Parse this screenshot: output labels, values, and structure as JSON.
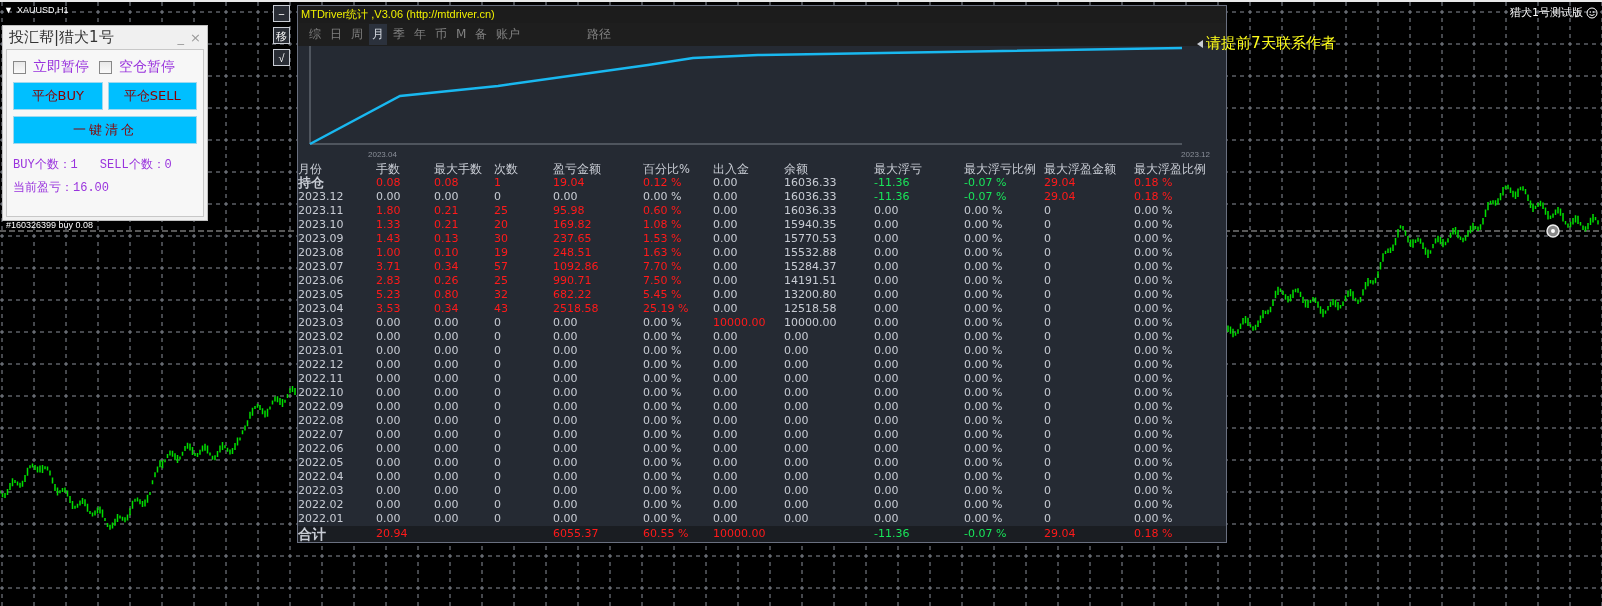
{
  "chart_header": {
    "menu_glyph": "▼",
    "symbol": "XAUUSD,H1"
  },
  "version_badge": "猎犬1号测试版",
  "side_buttons": [
    "−",
    "移",
    "√"
  ],
  "order_label": "#160326399 buy 0.08",
  "control_panel": {
    "title": "投汇帮|猎犬1号",
    "minimize": "_",
    "close": "×",
    "checkboxes": [
      {
        "label": "立即暂停",
        "checked": false
      },
      {
        "label": "空仓暂停",
        "checked": false
      }
    ],
    "buttons": [
      "平仓BUY",
      "平仓SELL"
    ],
    "wide_button": "一键清仓",
    "counts": [
      "BUY个数：1",
      "SELL个数：0"
    ],
    "profit": "当前盈亏：16.00"
  },
  "notice": "请提前7天联系作者",
  "stats_window": {
    "title": "MTDriver统计 ,V3.06 (http://mtdriver.cn)",
    "tabs": [
      {
        "label": "综",
        "selected": false
      },
      {
        "label": "日",
        "selected": false
      },
      {
        "label": "周",
        "selected": false
      },
      {
        "label": "月",
        "selected": true
      },
      {
        "label": "季",
        "selected": false
      },
      {
        "label": "年",
        "selected": false
      },
      {
        "label": "币",
        "selected": false
      },
      {
        "label": "M",
        "selected": false
      },
      {
        "label": "备",
        "selected": false
      },
      {
        "label": "账户",
        "selected": false
      },
      {
        "label": "路径",
        "selected": false
      }
    ],
    "curve": {
      "x_labels": [
        "2023.04",
        "2023.12"
      ]
    },
    "table": {
      "columns": [
        "月份",
        "手数",
        "最大手数",
        "次数",
        "盈亏金额",
        "百分比%",
        "出入金",
        "余额",
        "最大浮亏",
        "最大浮亏比例",
        "最大浮盈金额",
        "最大浮盈比例"
      ],
      "rows": [
        {
          "cells": [
            {
              "text": "持仓",
              "color": "#c8ccd4"
            },
            {
              "text": "0.08",
              "color": "#ff1a1a"
            },
            {
              "text": "0.08",
              "color": "#ff1a1a"
            },
            {
              "text": "1",
              "color": "#ff1a1a"
            },
            {
              "text": "19.04",
              "color": "#ff1a1a"
            },
            {
              "text": "0.12 %",
              "color": "#ff1a1a"
            },
            {
              "text": "0.00",
              "color": "#c8ccd4"
            },
            {
              "text": "16036.33",
              "color": "#c8ccd4"
            },
            {
              "text": "-11.36",
              "color": "#19e65a"
            },
            {
              "text": "-0.07 %",
              "color": "#19e65a"
            },
            {
              "text": "29.04",
              "color": "#ff1a1a"
            },
            {
              "text": "0.18 %",
              "color": "#ff1a1a"
            }
          ]
        },
        {
          "cells": [
            {
              "text": "2023.12",
              "color": "#c8ccd4"
            },
            {
              "text": "0.00",
              "color": "#c8ccd4"
            },
            {
              "text": "0.00",
              "color": "#c8ccd4"
            },
            {
              "text": "0",
              "color": "#c8ccd4"
            },
            {
              "text": "0.00",
              "color": "#c8ccd4"
            },
            {
              "text": "0.00 %",
              "color": "#c8ccd4"
            },
            {
              "text": "0.00",
              "color": "#c8ccd4"
            },
            {
              "text": "16036.33",
              "color": "#c8ccd4"
            },
            {
              "text": "-11.36",
              "color": "#19e65a"
            },
            {
              "text": "-0.07 %",
              "color": "#19e65a"
            },
            {
              "text": "29.04",
              "color": "#ff1a1a"
            },
            {
              "text": "0.18 %",
              "color": "#ff1a1a"
            }
          ]
        },
        {
          "cells": [
            {
              "text": "2023.11",
              "color": "#c8ccd4"
            },
            {
              "text": "1.80",
              "color": "#ff1a1a"
            },
            {
              "text": "0.21",
              "color": "#ff1a1a"
            },
            {
              "text": "25",
              "color": "#ff1a1a"
            },
            {
              "text": "95.98",
              "color": "#ff1a1a"
            },
            {
              "text": "0.60 %",
              "color": "#ff1a1a"
            },
            {
              "text": "0.00",
              "color": "#c8ccd4"
            },
            {
              "text": "16036.33",
              "color": "#c8ccd4"
            },
            {
              "text": "0.00",
              "color": "#c8ccd4"
            },
            {
              "text": "0.00 %",
              "color": "#c8ccd4"
            },
            {
              "text": "0",
              "color": "#c8ccd4"
            },
            {
              "text": "0.00 %",
              "color": "#c8ccd4"
            }
          ]
        },
        {
          "cells": [
            {
              "text": "2023.10",
              "color": "#c8ccd4"
            },
            {
              "text": "1.33",
              "color": "#ff1a1a"
            },
            {
              "text": "0.21",
              "color": "#ff1a1a"
            },
            {
              "text": "20",
              "color": "#ff1a1a"
            },
            {
              "text": "169.82",
              "color": "#ff1a1a"
            },
            {
              "text": "1.08 %",
              "color": "#ff1a1a"
            },
            {
              "text": "0.00",
              "color": "#c8ccd4"
            },
            {
              "text": "15940.35",
              "color": "#c8ccd4"
            },
            {
              "text": "0.00",
              "color": "#c8ccd4"
            },
            {
              "text": "0.00 %",
              "color": "#c8ccd4"
            },
            {
              "text": "0",
              "color": "#c8ccd4"
            },
            {
              "text": "0.00 %",
              "color": "#c8ccd4"
            }
          ]
        },
        {
          "cells": [
            {
              "text": "2023.09",
              "color": "#c8ccd4"
            },
            {
              "text": "1.43",
              "color": "#ff1a1a"
            },
            {
              "text": "0.13",
              "color": "#ff1a1a"
            },
            {
              "text": "30",
              "color": "#ff1a1a"
            },
            {
              "text": "237.65",
              "color": "#ff1a1a"
            },
            {
              "text": "1.53 %",
              "color": "#ff1a1a"
            },
            {
              "text": "0.00",
              "color": "#c8ccd4"
            },
            {
              "text": "15770.53",
              "color": "#c8ccd4"
            },
            {
              "text": "0.00",
              "color": "#c8ccd4"
            },
            {
              "text": "0.00 %",
              "color": "#c8ccd4"
            },
            {
              "text": "0",
              "color": "#c8ccd4"
            },
            {
              "text": "0.00 %",
              "color": "#c8ccd4"
            }
          ]
        },
        {
          "cells": [
            {
              "text": "2023.08",
              "color": "#c8ccd4"
            },
            {
              "text": "1.00",
              "color": "#ff1a1a"
            },
            {
              "text": "0.10",
              "color": "#ff1a1a"
            },
            {
              "text": "19",
              "color": "#ff1a1a"
            },
            {
              "text": "248.51",
              "color": "#ff1a1a"
            },
            {
              "text": "1.63 %",
              "color": "#ff1a1a"
            },
            {
              "text": "0.00",
              "color": "#c8ccd4"
            },
            {
              "text": "15532.88",
              "color": "#c8ccd4"
            },
            {
              "text": "0.00",
              "color": "#c8ccd4"
            },
            {
              "text": "0.00 %",
              "color": "#c8ccd4"
            },
            {
              "text": "0",
              "color": "#c8ccd4"
            },
            {
              "text": "0.00 %",
              "color": "#c8ccd4"
            }
          ]
        },
        {
          "cells": [
            {
              "text": "2023.07",
              "color": "#c8ccd4"
            },
            {
              "text": "3.71",
              "color": "#ff1a1a"
            },
            {
              "text": "0.34",
              "color": "#ff1a1a"
            },
            {
              "text": "57",
              "color": "#ff1a1a"
            },
            {
              "text": "1092.86",
              "color": "#ff1a1a"
            },
            {
              "text": "7.70 %",
              "color": "#ff1a1a"
            },
            {
              "text": "0.00",
              "color": "#c8ccd4"
            },
            {
              "text": "15284.37",
              "color": "#c8ccd4"
            },
            {
              "text": "0.00",
              "color": "#c8ccd4"
            },
            {
              "text": "0.00 %",
              "color": "#c8ccd4"
            },
            {
              "text": "0",
              "color": "#c8ccd4"
            },
            {
              "text": "0.00 %",
              "color": "#c8ccd4"
            }
          ]
        },
        {
          "cells": [
            {
              "text": "2023.06",
              "color": "#c8ccd4"
            },
            {
              "text": "2.83",
              "color": "#ff1a1a"
            },
            {
              "text": "0.26",
              "color": "#ff1a1a"
            },
            {
              "text": "25",
              "color": "#ff1a1a"
            },
            {
              "text": "990.71",
              "color": "#ff1a1a"
            },
            {
              "text": "7.50 %",
              "color": "#ff1a1a"
            },
            {
              "text": "0.00",
              "color": "#c8ccd4"
            },
            {
              "text": "14191.51",
              "color": "#c8ccd4"
            },
            {
              "text": "0.00",
              "color": "#c8ccd4"
            },
            {
              "text": "0.00 %",
              "color": "#c8ccd4"
            },
            {
              "text": "0",
              "color": "#c8ccd4"
            },
            {
              "text": "0.00 %",
              "color": "#c8ccd4"
            }
          ]
        },
        {
          "cells": [
            {
              "text": "2023.05",
              "color": "#c8ccd4"
            },
            {
              "text": "5.23",
              "color": "#ff1a1a"
            },
            {
              "text": "0.80",
              "color": "#ff1a1a"
            },
            {
              "text": "32",
              "color": "#ff1a1a"
            },
            {
              "text": "682.22",
              "color": "#ff1a1a"
            },
            {
              "text": "5.45 %",
              "color": "#ff1a1a"
            },
            {
              "text": "0.00",
              "color": "#c8ccd4"
            },
            {
              "text": "13200.80",
              "color": "#c8ccd4"
            },
            {
              "text": "0.00",
              "color": "#c8ccd4"
            },
            {
              "text": "0.00 %",
              "color": "#c8ccd4"
            },
            {
              "text": "0",
              "color": "#c8ccd4"
            },
            {
              "text": "0.00 %",
              "color": "#c8ccd4"
            }
          ]
        },
        {
          "cells": [
            {
              "text": "2023.04",
              "color": "#c8ccd4"
            },
            {
              "text": "3.53",
              "color": "#ff1a1a"
            },
            {
              "text": "0.34",
              "color": "#ff1a1a"
            },
            {
              "text": "43",
              "color": "#ff1a1a"
            },
            {
              "text": "2518.58",
              "color": "#ff1a1a"
            },
            {
              "text": "25.19 %",
              "color": "#ff1a1a"
            },
            {
              "text": "0.00",
              "color": "#c8ccd4"
            },
            {
              "text": "12518.58",
              "color": "#c8ccd4"
            },
            {
              "text": "0.00",
              "color": "#c8ccd4"
            },
            {
              "text": "0.00 %",
              "color": "#c8ccd4"
            },
            {
              "text": "0",
              "color": "#c8ccd4"
            },
            {
              "text": "0.00 %",
              "color": "#c8ccd4"
            }
          ]
        },
        {
          "cells": [
            {
              "text": "2023.03",
              "color": "#c8ccd4"
            },
            {
              "text": "0.00",
              "color": "#c8ccd4"
            },
            {
              "text": "0.00",
              "color": "#c8ccd4"
            },
            {
              "text": "0",
              "color": "#c8ccd4"
            },
            {
              "text": "0.00",
              "color": "#c8ccd4"
            },
            {
              "text": "0.00 %",
              "color": "#c8ccd4"
            },
            {
              "text": "10000.00",
              "color": "#ff1a1a"
            },
            {
              "text": "10000.00",
              "color": "#c8ccd4"
            },
            {
              "text": "0.00",
              "color": "#c8ccd4"
            },
            {
              "text": "0.00 %",
              "color": "#c8ccd4"
            },
            {
              "text": "0",
              "color": "#c8ccd4"
            },
            {
              "text": "0.00 %",
              "color": "#c8ccd4"
            }
          ]
        },
        {
          "cells": [
            {
              "text": "2023.02",
              "color": "#c8ccd4"
            },
            {
              "text": "0.00",
              "color": "#c8ccd4"
            },
            {
              "text": "0.00",
              "color": "#c8ccd4"
            },
            {
              "text": "0",
              "color": "#c8ccd4"
            },
            {
              "text": "0.00",
              "color": "#c8ccd4"
            },
            {
              "text": "0.00 %",
              "color": "#c8ccd4"
            },
            {
              "text": "0.00",
              "color": "#c8ccd4"
            },
            {
              "text": "0.00",
              "color": "#c8ccd4"
            },
            {
              "text": "0.00",
              "color": "#c8ccd4"
            },
            {
              "text": "0.00 %",
              "color": "#c8ccd4"
            },
            {
              "text": "0",
              "color": "#c8ccd4"
            },
            {
              "text": "0.00 %",
              "color": "#c8ccd4"
            }
          ]
        },
        {
          "cells": [
            {
              "text": "2023.01",
              "color": "#c8ccd4"
            },
            {
              "text": "0.00",
              "color": "#c8ccd4"
            },
            {
              "text": "0.00",
              "color": "#c8ccd4"
            },
            {
              "text": "0",
              "color": "#c8ccd4"
            },
            {
              "text": "0.00",
              "color": "#c8ccd4"
            },
            {
              "text": "0.00 %",
              "color": "#c8ccd4"
            },
            {
              "text": "0.00",
              "color": "#c8ccd4"
            },
            {
              "text": "0.00",
              "color": "#c8ccd4"
            },
            {
              "text": "0.00",
              "color": "#c8ccd4"
            },
            {
              "text": "0.00 %",
              "color": "#c8ccd4"
            },
            {
              "text": "0",
              "color": "#c8ccd4"
            },
            {
              "text": "0.00 %",
              "color": "#c8ccd4"
            }
          ]
        },
        {
          "cells": [
            {
              "text": "2022.12",
              "color": "#c8ccd4"
            },
            {
              "text": "0.00",
              "color": "#c8ccd4"
            },
            {
              "text": "0.00",
              "color": "#c8ccd4"
            },
            {
              "text": "0",
              "color": "#c8ccd4"
            },
            {
              "text": "0.00",
              "color": "#c8ccd4"
            },
            {
              "text": "0.00 %",
              "color": "#c8ccd4"
            },
            {
              "text": "0.00",
              "color": "#c8ccd4"
            },
            {
              "text": "0.00",
              "color": "#c8ccd4"
            },
            {
              "text": "0.00",
              "color": "#c8ccd4"
            },
            {
              "text": "0.00 %",
              "color": "#c8ccd4"
            },
            {
              "text": "0",
              "color": "#c8ccd4"
            },
            {
              "text": "0.00 %",
              "color": "#c8ccd4"
            }
          ]
        },
        {
          "cells": [
            {
              "text": "2022.11",
              "color": "#c8ccd4"
            },
            {
              "text": "0.00",
              "color": "#c8ccd4"
            },
            {
              "text": "0.00",
              "color": "#c8ccd4"
            },
            {
              "text": "0",
              "color": "#c8ccd4"
            },
            {
              "text": "0.00",
              "color": "#c8ccd4"
            },
            {
              "text": "0.00 %",
              "color": "#c8ccd4"
            },
            {
              "text": "0.00",
              "color": "#c8ccd4"
            },
            {
              "text": "0.00",
              "color": "#c8ccd4"
            },
            {
              "text": "0.00",
              "color": "#c8ccd4"
            },
            {
              "text": "0.00 %",
              "color": "#c8ccd4"
            },
            {
              "text": "0",
              "color": "#c8ccd4"
            },
            {
              "text": "0.00 %",
              "color": "#c8ccd4"
            }
          ]
        },
        {
          "cells": [
            {
              "text": "2022.10",
              "color": "#c8ccd4"
            },
            {
              "text": "0.00",
              "color": "#c8ccd4"
            },
            {
              "text": "0.00",
              "color": "#c8ccd4"
            },
            {
              "text": "0",
              "color": "#c8ccd4"
            },
            {
              "text": "0.00",
              "color": "#c8ccd4"
            },
            {
              "text": "0.00 %",
              "color": "#c8ccd4"
            },
            {
              "text": "0.00",
              "color": "#c8ccd4"
            },
            {
              "text": "0.00",
              "color": "#c8ccd4"
            },
            {
              "text": "0.00",
              "color": "#c8ccd4"
            },
            {
              "text": "0.00 %",
              "color": "#c8ccd4"
            },
            {
              "text": "0",
              "color": "#c8ccd4"
            },
            {
              "text": "0.00 %",
              "color": "#c8ccd4"
            }
          ]
        },
        {
          "cells": [
            {
              "text": "2022.09",
              "color": "#c8ccd4"
            },
            {
              "text": "0.00",
              "color": "#c8ccd4"
            },
            {
              "text": "0.00",
              "color": "#c8ccd4"
            },
            {
              "text": "0",
              "color": "#c8ccd4"
            },
            {
              "text": "0.00",
              "color": "#c8ccd4"
            },
            {
              "text": "0.00 %",
              "color": "#c8ccd4"
            },
            {
              "text": "0.00",
              "color": "#c8ccd4"
            },
            {
              "text": "0.00",
              "color": "#c8ccd4"
            },
            {
              "text": "0.00",
              "color": "#c8ccd4"
            },
            {
              "text": "0.00 %",
              "color": "#c8ccd4"
            },
            {
              "text": "0",
              "color": "#c8ccd4"
            },
            {
              "text": "0.00 %",
              "color": "#c8ccd4"
            }
          ]
        },
        {
          "cells": [
            {
              "text": "2022.08",
              "color": "#c8ccd4"
            },
            {
              "text": "0.00",
              "color": "#c8ccd4"
            },
            {
              "text": "0.00",
              "color": "#c8ccd4"
            },
            {
              "text": "0",
              "color": "#c8ccd4"
            },
            {
              "text": "0.00",
              "color": "#c8ccd4"
            },
            {
              "text": "0.00 %",
              "color": "#c8ccd4"
            },
            {
              "text": "0.00",
              "color": "#c8ccd4"
            },
            {
              "text": "0.00",
              "color": "#c8ccd4"
            },
            {
              "text": "0.00",
              "color": "#c8ccd4"
            },
            {
              "text": "0.00 %",
              "color": "#c8ccd4"
            },
            {
              "text": "0",
              "color": "#c8ccd4"
            },
            {
              "text": "0.00 %",
              "color": "#c8ccd4"
            }
          ]
        },
        {
          "cells": [
            {
              "text": "2022.07",
              "color": "#c8ccd4"
            },
            {
              "text": "0.00",
              "color": "#c8ccd4"
            },
            {
              "text": "0.00",
              "color": "#c8ccd4"
            },
            {
              "text": "0",
              "color": "#c8ccd4"
            },
            {
              "text": "0.00",
              "color": "#c8ccd4"
            },
            {
              "text": "0.00 %",
              "color": "#c8ccd4"
            },
            {
              "text": "0.00",
              "color": "#c8ccd4"
            },
            {
              "text": "0.00",
              "color": "#c8ccd4"
            },
            {
              "text": "0.00",
              "color": "#c8ccd4"
            },
            {
              "text": "0.00 %",
              "color": "#c8ccd4"
            },
            {
              "text": "0",
              "color": "#c8ccd4"
            },
            {
              "text": "0.00 %",
              "color": "#c8ccd4"
            }
          ]
        },
        {
          "cells": [
            {
              "text": "2022.06",
              "color": "#c8ccd4"
            },
            {
              "text": "0.00",
              "color": "#c8ccd4"
            },
            {
              "text": "0.00",
              "color": "#c8ccd4"
            },
            {
              "text": "0",
              "color": "#c8ccd4"
            },
            {
              "text": "0.00",
              "color": "#c8ccd4"
            },
            {
              "text": "0.00 %",
              "color": "#c8ccd4"
            },
            {
              "text": "0.00",
              "color": "#c8ccd4"
            },
            {
              "text": "0.00",
              "color": "#c8ccd4"
            },
            {
              "text": "0.00",
              "color": "#c8ccd4"
            },
            {
              "text": "0.00 %",
              "color": "#c8ccd4"
            },
            {
              "text": "0",
              "color": "#c8ccd4"
            },
            {
              "text": "0.00 %",
              "color": "#c8ccd4"
            }
          ]
        },
        {
          "cells": [
            {
              "text": "2022.05",
              "color": "#c8ccd4"
            },
            {
              "text": "0.00",
              "color": "#c8ccd4"
            },
            {
              "text": "0.00",
              "color": "#c8ccd4"
            },
            {
              "text": "0",
              "color": "#c8ccd4"
            },
            {
              "text": "0.00",
              "color": "#c8ccd4"
            },
            {
              "text": "0.00 %",
              "color": "#c8ccd4"
            },
            {
              "text": "0.00",
              "color": "#c8ccd4"
            },
            {
              "text": "0.00",
              "color": "#c8ccd4"
            },
            {
              "text": "0.00",
              "color": "#c8ccd4"
            },
            {
              "text": "0.00 %",
              "color": "#c8ccd4"
            },
            {
              "text": "0",
              "color": "#c8ccd4"
            },
            {
              "text": "0.00 %",
              "color": "#c8ccd4"
            }
          ]
        },
        {
          "cells": [
            {
              "text": "2022.04",
              "color": "#c8ccd4"
            },
            {
              "text": "0.00",
              "color": "#c8ccd4"
            },
            {
              "text": "0.00",
              "color": "#c8ccd4"
            },
            {
              "text": "0",
              "color": "#c8ccd4"
            },
            {
              "text": "0.00",
              "color": "#c8ccd4"
            },
            {
              "text": "0.00 %",
              "color": "#c8ccd4"
            },
            {
              "text": "0.00",
              "color": "#c8ccd4"
            },
            {
              "text": "0.00",
              "color": "#c8ccd4"
            },
            {
              "text": "0.00",
              "color": "#c8ccd4"
            },
            {
              "text": "0.00 %",
              "color": "#c8ccd4"
            },
            {
              "text": "0",
              "color": "#c8ccd4"
            },
            {
              "text": "0.00 %",
              "color": "#c8ccd4"
            }
          ]
        },
        {
          "cells": [
            {
              "text": "2022.03",
              "color": "#c8ccd4"
            },
            {
              "text": "0.00",
              "color": "#c8ccd4"
            },
            {
              "text": "0.00",
              "color": "#c8ccd4"
            },
            {
              "text": "0",
              "color": "#c8ccd4"
            },
            {
              "text": "0.00",
              "color": "#c8ccd4"
            },
            {
              "text": "0.00 %",
              "color": "#c8ccd4"
            },
            {
              "text": "0.00",
              "color": "#c8ccd4"
            },
            {
              "text": "0.00",
              "color": "#c8ccd4"
            },
            {
              "text": "0.00",
              "color": "#c8ccd4"
            },
            {
              "text": "0.00 %",
              "color": "#c8ccd4"
            },
            {
              "text": "0",
              "color": "#c8ccd4"
            },
            {
              "text": "0.00 %",
              "color": "#c8ccd4"
            }
          ]
        },
        {
          "cells": [
            {
              "text": "2022.02",
              "color": "#c8ccd4"
            },
            {
              "text": "0.00",
              "color": "#c8ccd4"
            },
            {
              "text": "0.00",
              "color": "#c8ccd4"
            },
            {
              "text": "0",
              "color": "#c8ccd4"
            },
            {
              "text": "0.00",
              "color": "#c8ccd4"
            },
            {
              "text": "0.00 %",
              "color": "#c8ccd4"
            },
            {
              "text": "0.00",
              "color": "#c8ccd4"
            },
            {
              "text": "0.00",
              "color": "#c8ccd4"
            },
            {
              "text": "0.00",
              "color": "#c8ccd4"
            },
            {
              "text": "0.00 %",
              "color": "#c8ccd4"
            },
            {
              "text": "0",
              "color": "#c8ccd4"
            },
            {
              "text": "0.00 %",
              "color": "#c8ccd4"
            }
          ]
        },
        {
          "cells": [
            {
              "text": "2022.01",
              "color": "#c8ccd4"
            },
            {
              "text": "0.00",
              "color": "#c8ccd4"
            },
            {
              "text": "0.00",
              "color": "#c8ccd4"
            },
            {
              "text": "0",
              "color": "#c8ccd4"
            },
            {
              "text": "0.00",
              "color": "#c8ccd4"
            },
            {
              "text": "0.00 %",
              "color": "#c8ccd4"
            },
            {
              "text": "0.00",
              "color": "#c8ccd4"
            },
            {
              "text": "0.00",
              "color": "#c8ccd4"
            },
            {
              "text": "0.00",
              "color": "#c8ccd4"
            },
            {
              "text": "0.00 %",
              "color": "#c8ccd4"
            },
            {
              "text": "0",
              "color": "#c8ccd4"
            },
            {
              "text": "0.00 %",
              "color": "#c8ccd4"
            }
          ]
        }
      ],
      "total": {
        "cells": [
          {
            "text": "合计",
            "color": "#c8ccd4"
          },
          {
            "text": "20.94",
            "color": "#ff1a1a"
          },
          null,
          null,
          {
            "text": "6055.37",
            "color": "#ff1a1a"
          },
          {
            "text": "60.55 %",
            "color": "#ff1a1a"
          },
          {
            "text": "10000.00",
            "color": "#ff1a1a"
          },
          null,
          {
            "text": "-11.36",
            "color": "#19e65a"
          },
          {
            "text": "-0.07 %",
            "color": "#19e65a"
          },
          {
            "text": "29.04",
            "color": "#ff1a1a"
          },
          {
            "text": "0.18 %",
            "color": "#ff1a1a"
          }
        ]
      }
    }
  }
}
